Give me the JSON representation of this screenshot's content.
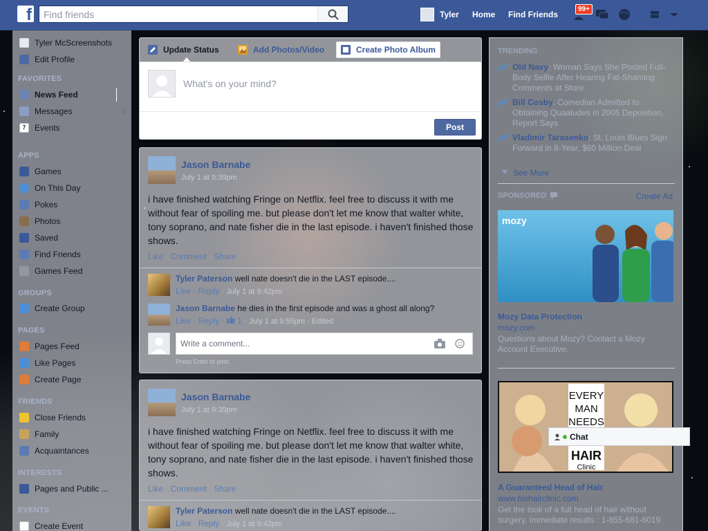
{
  "topbar": {
    "search_placeholder": "Find friends",
    "user_name": "Tyler",
    "home": "Home",
    "find_friends": "Find Friends",
    "friend_requests_badge": "99+"
  },
  "leftnav": {
    "profile_name": "Tyler McScreenshots",
    "edit_profile": "Edit Profile",
    "favorites_head": "FAVORITES",
    "favorites": [
      {
        "label": "News Feed",
        "icon": "news-feed-icon"
      },
      {
        "label": "Messages",
        "icon": "messages-icon",
        "count": "2"
      },
      {
        "label": "Events",
        "icon": "calendar-icon",
        "icon_text": "7"
      }
    ],
    "apps_head": "APPS",
    "apps": [
      {
        "label": "Games",
        "icon": "games-icon"
      },
      {
        "label": "On This Day",
        "icon": "clock-icon"
      },
      {
        "label": "Pokes",
        "icon": "poke-icon"
      },
      {
        "label": "Photos",
        "icon": "photos-icon"
      },
      {
        "label": "Saved",
        "icon": "bookmark-icon"
      },
      {
        "label": "Find Friends",
        "icon": "find-friends-icon"
      },
      {
        "label": "Games Feed",
        "icon": "gamepad-icon"
      }
    ],
    "groups_head": "GROUPS",
    "groups": [
      {
        "label": "Create Group",
        "icon": "plus-icon"
      }
    ],
    "pages_head": "PAGES",
    "pages": [
      {
        "label": "Pages Feed",
        "icon": "megaphone-icon"
      },
      {
        "label": "Like Pages",
        "icon": "thumbs-up-icon"
      },
      {
        "label": "Create Page",
        "icon": "plus-icon"
      }
    ],
    "friends_head": "FRIENDS",
    "friends": [
      {
        "label": "Close Friends",
        "icon": "star-icon"
      },
      {
        "label": "Family",
        "icon": "family-icon"
      },
      {
        "label": "Acquaintances",
        "icon": "acquaintances-icon"
      }
    ],
    "interests_head": "INTERESTS",
    "interests": [
      {
        "label": "Pages and Public ...",
        "icon": "rss-icon"
      }
    ],
    "events_head": "EVENTS",
    "events": [
      {
        "label": "Create Event",
        "icon": "plus-icon"
      }
    ]
  },
  "composer": {
    "tabs": [
      "Update Status",
      "Add Photos/Video",
      "Create Photo Album"
    ],
    "placeholder": "What's on your mind?",
    "post_label": "Post"
  },
  "stories": [
    {
      "author": "Jason Barnabe",
      "time": "July 1 at 9:39pm",
      "text": "i have finished watching Fringe on Netflix. feel free to discuss it with me without fear of spoiling me. but please don't let me know that walter white, tony soprano, and nate fisher die in the last episode. i haven't finished those shows.",
      "actions": {
        "like": "Like",
        "comment": "Comment",
        "share": "Share"
      },
      "comments": [
        {
          "author": "Tyler Paterson",
          "text": "well nate doesn't die in the LAST episode....",
          "like": "Like",
          "reply": "Reply",
          "time": "July 1 at 9:42pm"
        },
        {
          "author": "Jason Barnabe",
          "text": "he dies in the first episode and was a ghost all along?",
          "like": "Like",
          "reply": "Reply",
          "likes": "1",
          "time": "July 1 at 9:55pm",
          "edited": "Edited"
        }
      ],
      "write_placeholder": "Write a comment...",
      "enter_hint": "Press Enter to post."
    },
    {
      "author": "Jason Barnabe",
      "time": "July 1 at 9:39pm",
      "text": "i have finished watching Fringe on Netflix. feel free to discuss it with me without fear of spoiling me. but please don't let me know that walter white, tony soprano, and nate fisher die in the last episode. i haven't finished those shows.",
      "actions": {
        "like": "Like",
        "comment": "Comment",
        "share": "Share"
      },
      "comments": [
        {
          "author": "Tyler Paterson",
          "text": "well nate doesn't die in the LAST episode....",
          "like": "Like",
          "reply": "Reply",
          "time": "July 1 at 9:42pm"
        }
      ]
    }
  ],
  "right": {
    "trending_head": "TRENDING",
    "trending": [
      {
        "title": "Old Navy",
        "desc": ": Woman Says She Posted Full-Body Selfie After Hearing Fat-Shaming Comments at Store"
      },
      {
        "title": "Bill Cosby",
        "desc": ": Comedian Admitted to Obtaining Quaaludes in 2005 Deposition, Report Says"
      },
      {
        "title": "Vladimir Tarasenko",
        "desc": ": St. Louis Blues Sign Forward in 8-Year, $60 Million Deal"
      }
    ],
    "see_more": "See More",
    "sponsored_head": "SPONSORED",
    "create_ad": "Create Ad",
    "ads": [
      {
        "logo": "mozy",
        "title": "Mozy Data Protection",
        "url": "mozy.com",
        "desc": "Questions about Mozy? Contact a Mozy Account Executive."
      },
      {
        "banner_lines": [
          "EVERY",
          "MAN",
          "NEEDS"
        ],
        "banner_bottom": "HAIR",
        "banner_sub": "Clinic",
        "title": "A Guaranteed Head of Hair",
        "url": "www.hishairclinic.com",
        "desc": "Get the look of a full head of hair without surgery, immediate results : 1-855-681-6019"
      }
    ]
  },
  "chat": {
    "label": "Chat"
  },
  "colors": {
    "brand": "#3b5998",
    "link": "#3b5998",
    "post_button": "#4e69a2",
    "badge": "#f03d25"
  }
}
